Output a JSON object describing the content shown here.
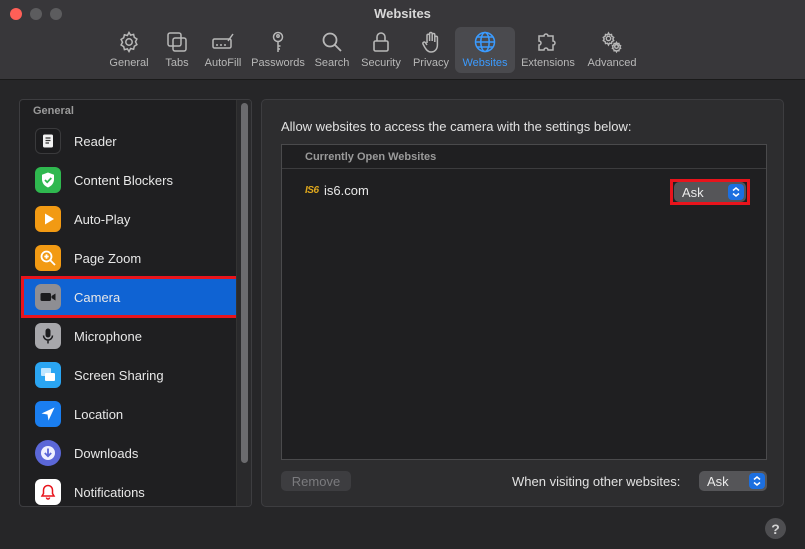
{
  "window": {
    "title": "Websites"
  },
  "toolbar": {
    "items": [
      {
        "label": "General",
        "icon": "gear-icon"
      },
      {
        "label": "Tabs",
        "icon": "tabs-icon"
      },
      {
        "label": "AutoFill",
        "icon": "autofill-icon"
      },
      {
        "label": "Passwords",
        "icon": "key-icon"
      },
      {
        "label": "Search",
        "icon": "search-icon"
      },
      {
        "label": "Security",
        "icon": "lock-icon"
      },
      {
        "label": "Privacy",
        "icon": "hand-icon"
      },
      {
        "label": "Websites",
        "icon": "globe-icon",
        "active": true
      },
      {
        "label": "Extensions",
        "icon": "puzzle-icon"
      },
      {
        "label": "Advanced",
        "icon": "gears-icon"
      }
    ],
    "accent_color": "#3b9bff"
  },
  "sidebar": {
    "header": "General",
    "items": [
      {
        "label": "Reader",
        "icon": "reader-icon",
        "color": "#1c1c1e"
      },
      {
        "label": "Content Blockers",
        "icon": "shield-check-icon",
        "color": "#2fb84f"
      },
      {
        "label": "Auto-Play",
        "icon": "play-icon",
        "color": "#f29a13"
      },
      {
        "label": "Page Zoom",
        "icon": "zoom-icon",
        "color": "#f29a13"
      },
      {
        "label": "Camera",
        "icon": "camera-icon",
        "color": "#8e8e93",
        "selected": true
      },
      {
        "label": "Microphone",
        "icon": "microphone-icon",
        "color": "#a7a7ab"
      },
      {
        "label": "Screen Sharing",
        "icon": "screen-sharing-icon",
        "color": "#2aa5f2"
      },
      {
        "label": "Location",
        "icon": "location-icon",
        "color": "#1a7ef0"
      },
      {
        "label": "Downloads",
        "icon": "download-icon",
        "color": "#5b67d8"
      },
      {
        "label": "Notifications",
        "icon": "bell-icon",
        "color": "#ffffff"
      }
    ],
    "selected_color": "#0f63d3",
    "highlight_color": "#e8141c"
  },
  "main": {
    "description": "Allow websites to access the camera with the settings below:",
    "list_header": "Currently Open Websites",
    "sites": [
      {
        "favicon_text": "IS6",
        "name": "is6.com",
        "setting": "Ask"
      }
    ],
    "remove_label": "Remove",
    "other_label": "When visiting other websites:",
    "other_setting": "Ask"
  },
  "help": {
    "label": "?"
  }
}
